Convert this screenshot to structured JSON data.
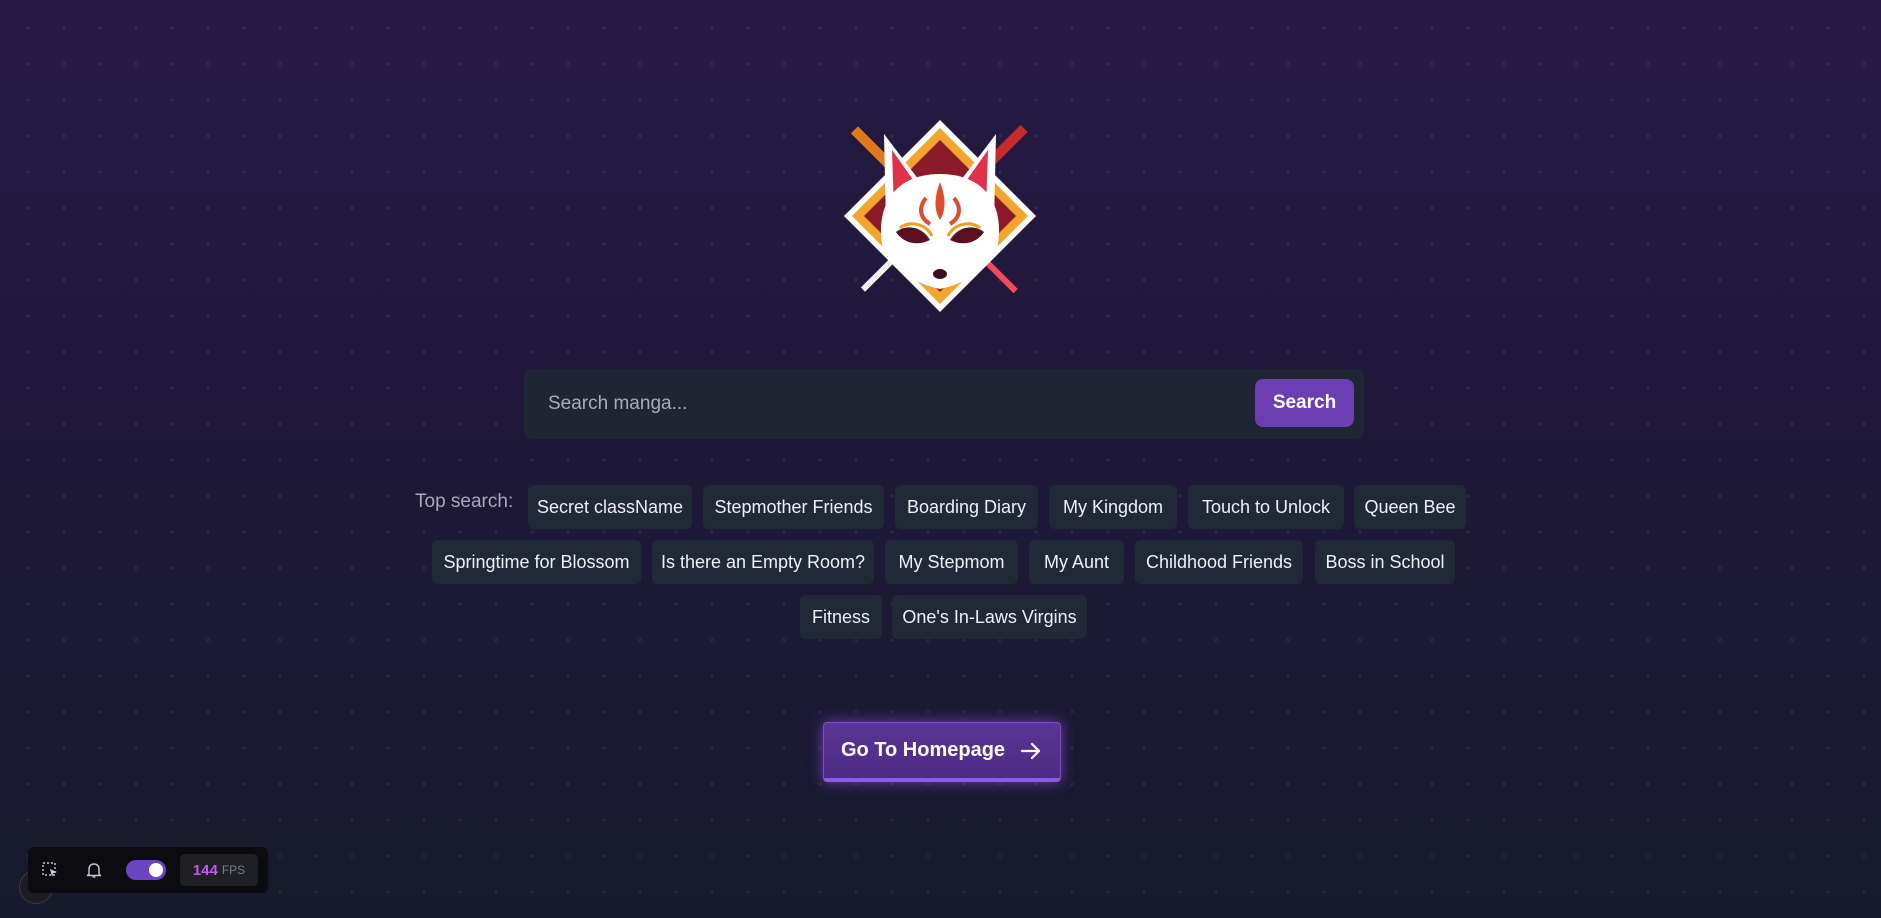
{
  "colors": {
    "accent": "#6b3fb3",
    "chip_bg": "#212836",
    "search_bg": "#1f2532",
    "fps_value": "#c15be6"
  },
  "logo": {
    "icon": "kitsune-fox-mask-logo"
  },
  "search": {
    "placeholder": "Search manga...",
    "value": "",
    "button_label": "Search"
  },
  "top_search": {
    "label": "Top search:",
    "items": [
      "Secret className",
      "Stepmother Friends",
      "Boarding Diary",
      "My Kingdom",
      "Touch to Unlock",
      "Queen Bee",
      "Springtime for Blossom",
      "Is there an Empty Room?",
      "My Stepmom",
      "My Aunt",
      "Childhood Friends",
      "Boss in School",
      "Fitness",
      "One's In-Laws Virgins"
    ]
  },
  "home_button": {
    "label": "Go To Homepage",
    "icon": "arrow-right-icon"
  },
  "devbar": {
    "select_icon": "selection-cursor-icon",
    "bell_icon": "bell-icon",
    "toggle_on": true,
    "fps_value": "144",
    "fps_unit": "FPS"
  }
}
